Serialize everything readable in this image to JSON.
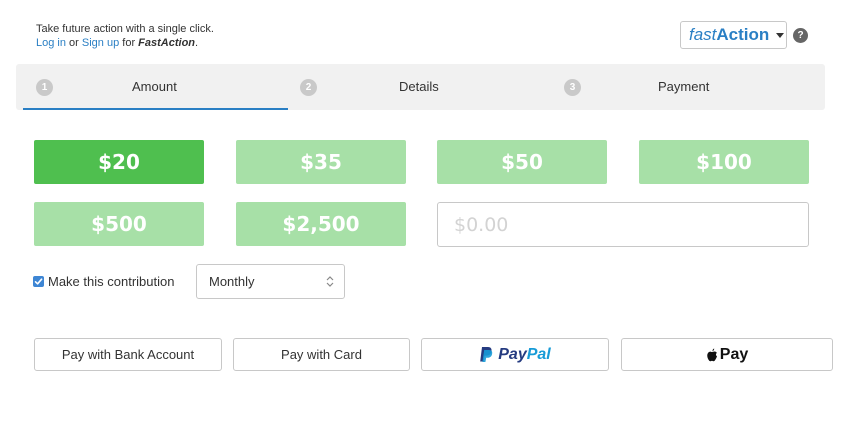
{
  "promo": {
    "line1": "Take future action with a single click.",
    "login": "Log in",
    "or": "or",
    "signup": "Sign up",
    "for": "for",
    "brand": "FastAction",
    "period": "."
  },
  "fastaction": {
    "fast": "fast",
    "action": "Action",
    "help": "?"
  },
  "steps": [
    {
      "num": "1",
      "label": "Amount",
      "active": true
    },
    {
      "num": "2",
      "label": "Details",
      "active": false
    },
    {
      "num": "3",
      "label": "Payment",
      "active": false
    }
  ],
  "amounts": [
    {
      "label": "$20",
      "selected": true
    },
    {
      "label": "$35",
      "selected": false
    },
    {
      "label": "$50",
      "selected": false
    },
    {
      "label": "$100",
      "selected": false
    },
    {
      "label": "$500",
      "selected": false
    },
    {
      "label": "$2,500",
      "selected": false
    }
  ],
  "custom_amount": {
    "value": "",
    "placeholder": "$0.00"
  },
  "recurring": {
    "checked": true,
    "label": "Make this contribution",
    "frequency": "Monthly"
  },
  "payment_options": {
    "bank": "Pay with Bank Account",
    "card": "Pay with Card",
    "paypal_pay": "Pay",
    "paypal_pal": "Pal",
    "apple_pay": "Pay"
  },
  "colors": {
    "selected_green": "#4fbf4f",
    "unselected_green": "#a7e0a7",
    "link_blue": "#2a7fc4",
    "checkbox_blue": "#3e86d4",
    "paypal_dark": "#253b80",
    "paypal_light": "#179bd7"
  }
}
